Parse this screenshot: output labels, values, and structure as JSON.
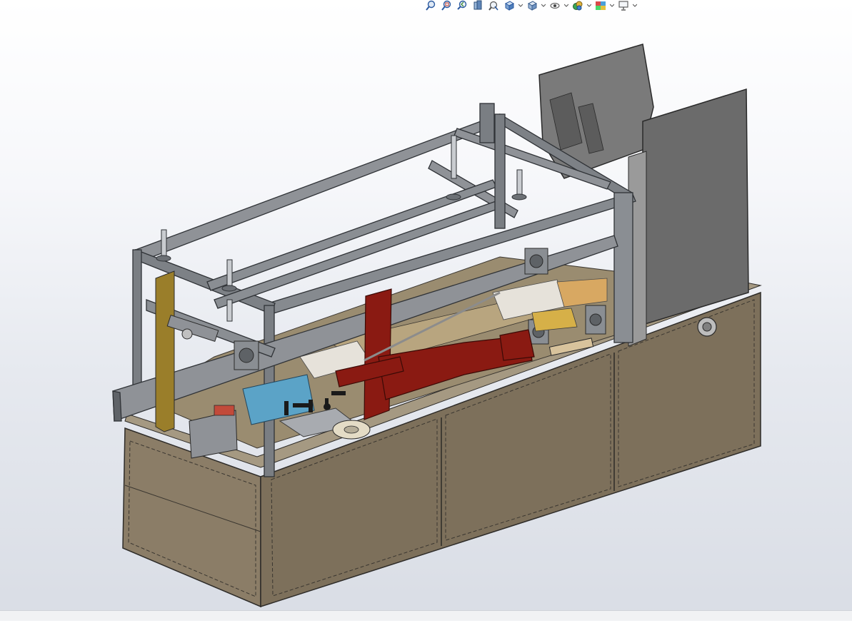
{
  "app": {
    "title": ""
  },
  "heads_up_toolbar": {
    "buttons": [
      {
        "name": "zoom-to-fit-icon"
      },
      {
        "name": "zoom-to-area-icon"
      },
      {
        "name": "previous-view-icon"
      },
      {
        "name": "section-view-icon"
      },
      {
        "name": "dynamic-annotation-icon"
      },
      {
        "name": "view-orientation-icon",
        "dropdown": true
      },
      {
        "name": "display-style-icon",
        "dropdown": true
      },
      {
        "name": "hide-show-items-icon",
        "dropdown": true
      },
      {
        "name": "edit-appearance-icon",
        "dropdown": true
      },
      {
        "name": "apply-scene-icon",
        "dropdown": true
      },
      {
        "name": "view-settings-icon",
        "dropdown": true
      }
    ]
  },
  "model": {
    "description_visible": false,
    "colors": {
      "cabinet": "#8b7d67",
      "cabinet_dark": "#6f6450",
      "frame": "#8f9297",
      "frame_dark": "#5f6368",
      "panel": "#6b6b6b",
      "red_arm": "#8a1a12",
      "blue_block": "#5ba3c7",
      "tan_box": "#d8c39c",
      "background_top": "#ffffff",
      "background_bottom": "#d9dde5"
    }
  }
}
